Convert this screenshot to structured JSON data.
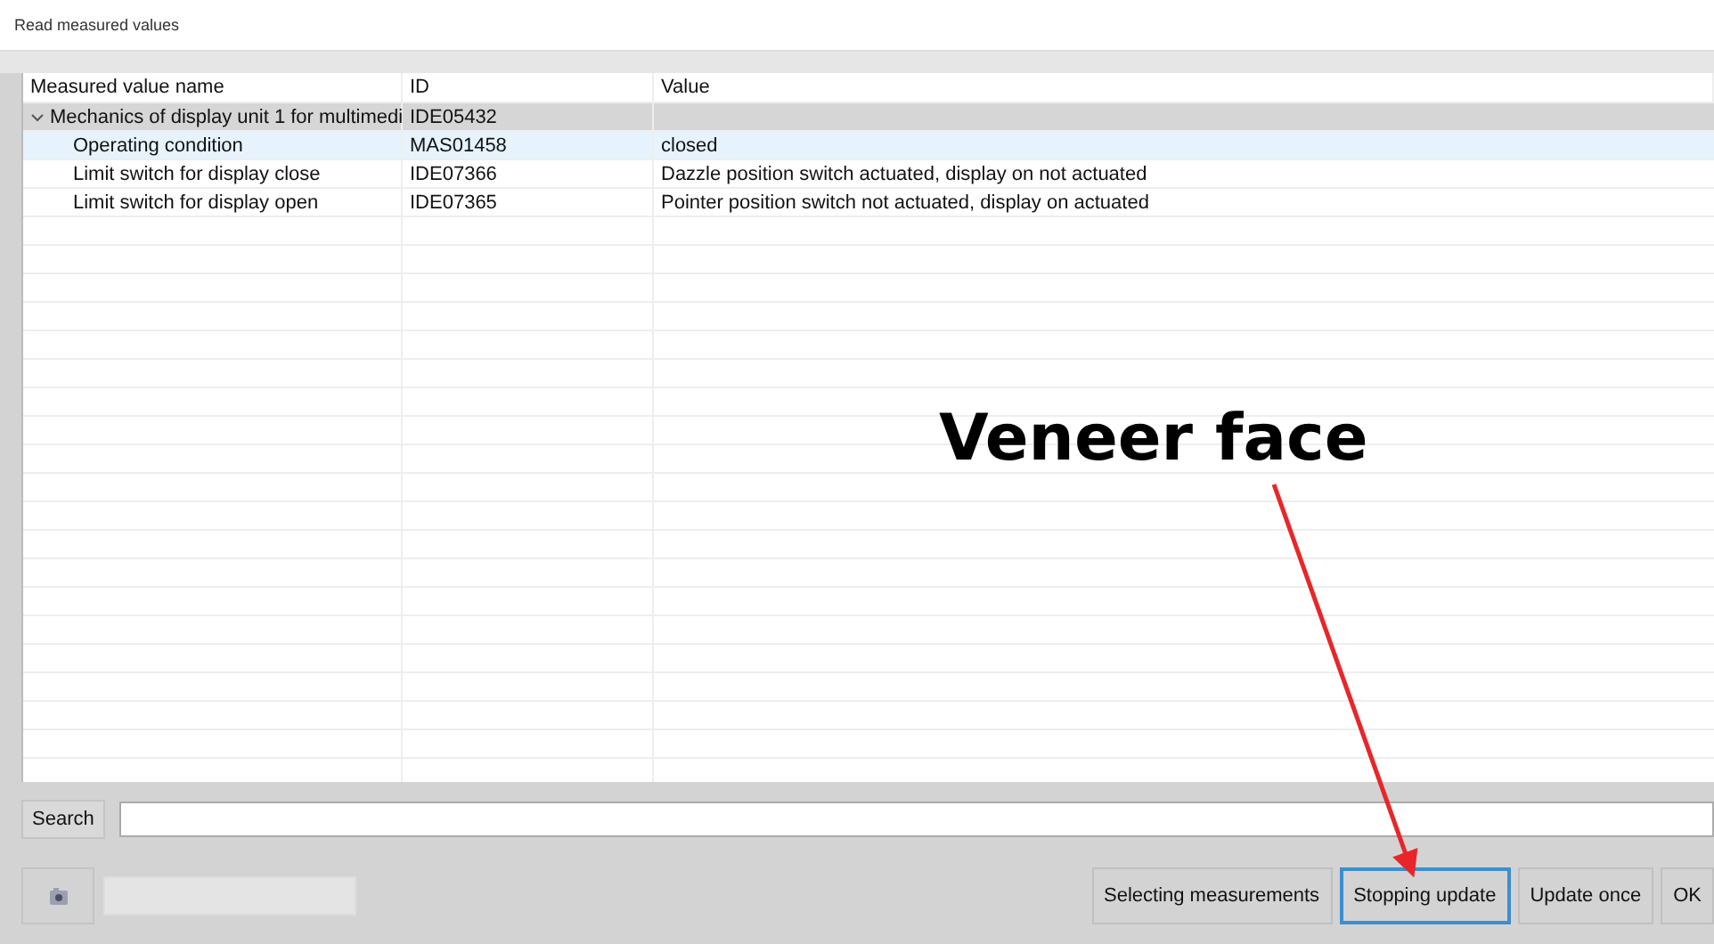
{
  "window": {
    "title": "Read measured values"
  },
  "table": {
    "columns": [
      "Measured value name",
      "ID",
      "Value"
    ],
    "rows": [
      {
        "name": "Mechanics of display unit 1 for multimedi",
        "id": "IDE05432",
        "value": null,
        "expanded": true,
        "selected": false,
        "children": [
          {
            "name": "Operating condition",
            "id": "MAS01458",
            "value": "closed",
            "selected": true
          },
          {
            "name": "Limit switch for display close",
            "id": "IDE07366",
            "value": "Dazzle position switch actuated, display on not actuated",
            "selected": false
          },
          {
            "name": "Limit switch for display open",
            "id": "IDE07365",
            "value": "Pointer position switch not actuated, display on actuated",
            "selected": false
          }
        ]
      }
    ]
  },
  "search": {
    "label": "Search"
  },
  "buttons": [
    {
      "label": "Selecting measurements",
      "focused": false
    },
    {
      "label": "Stopping update",
      "focused": true
    },
    {
      "label": "Update once",
      "focused": false
    },
    {
      "label": "OK",
      "focused": false
    }
  ],
  "annotation": {
    "text": "Veneer face"
  }
}
